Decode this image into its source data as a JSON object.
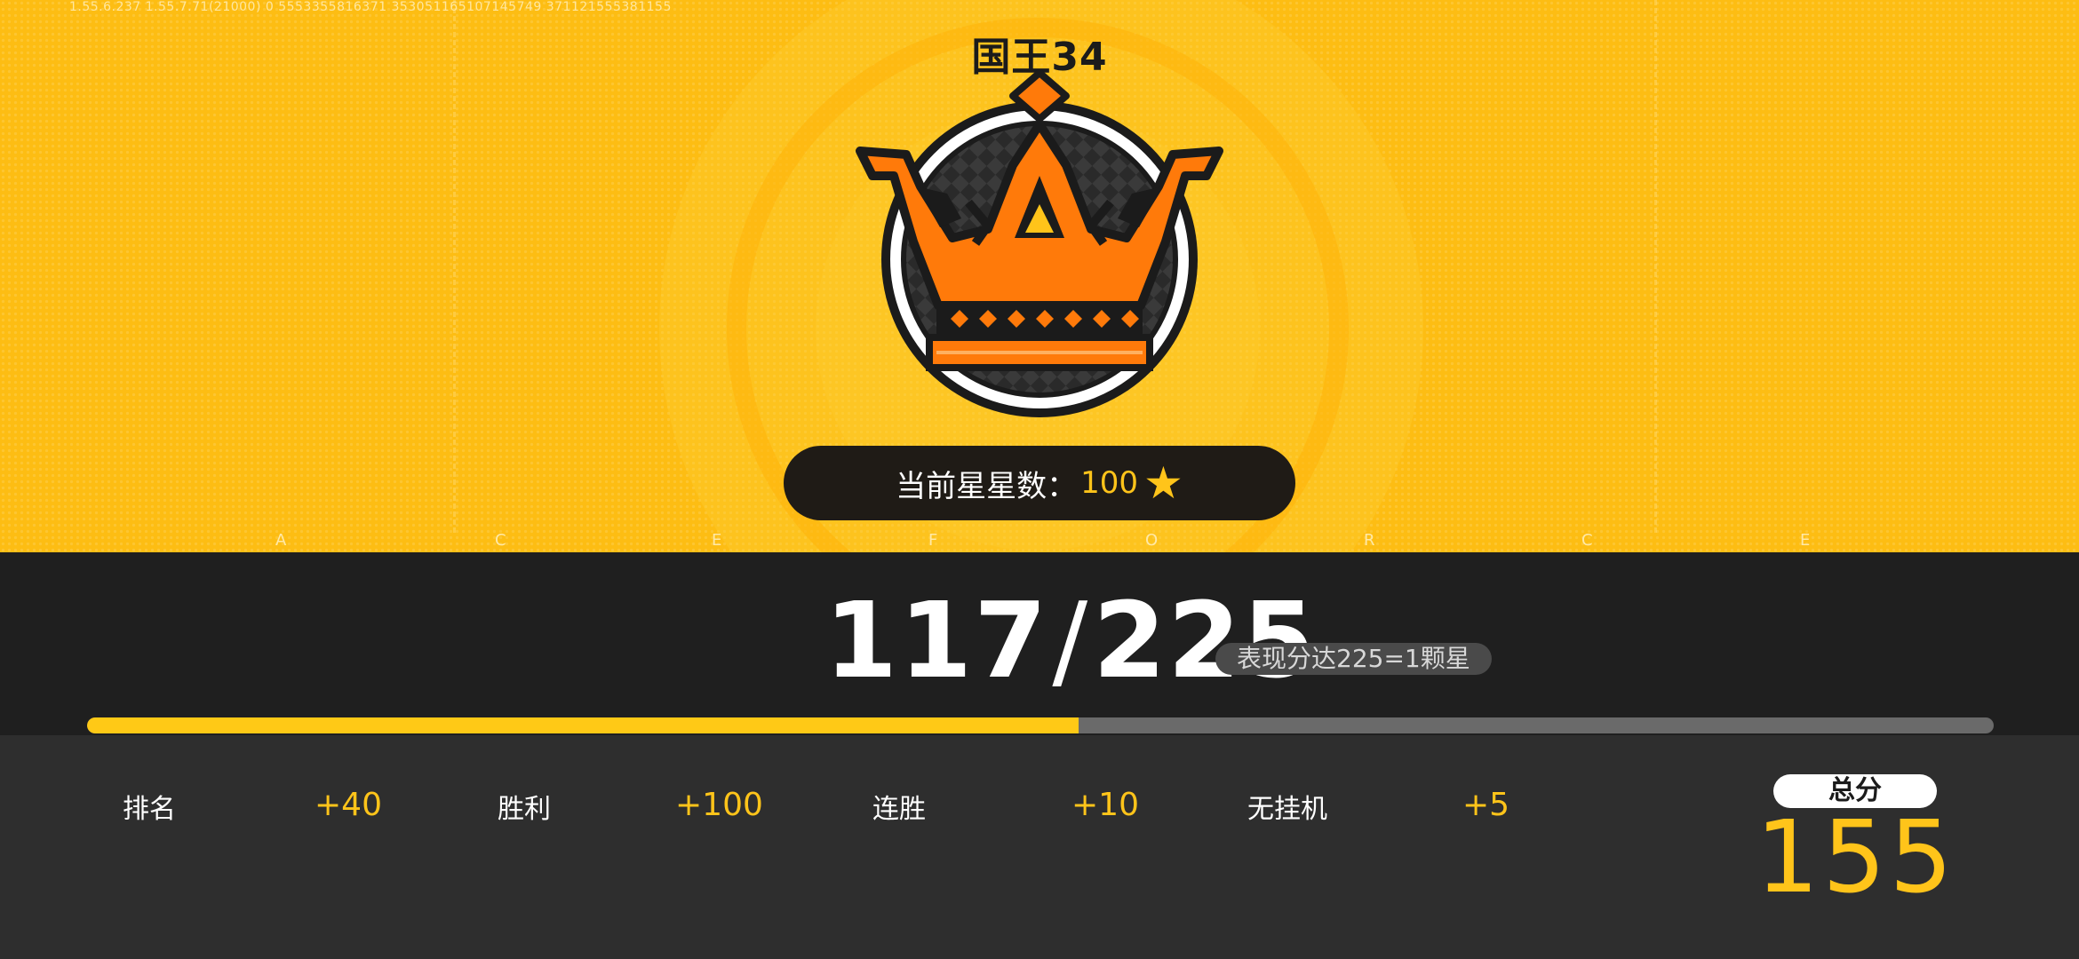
{
  "header": {
    "version_text": "1.55.6.237  1.55.7.71(21000)  0  5553355816371  353051165107145749  371121555381155",
    "rank_title": "国王34"
  },
  "stars": {
    "label": "当前星星数：",
    "value": "100",
    "icon": "star-icon",
    "star_glyph": "★"
  },
  "deco_letters": [
    "A",
    "C",
    "E",
    "F",
    "O",
    "R",
    "C",
    "E"
  ],
  "progress": {
    "current": "117",
    "separator": "/",
    "target": "225",
    "fraction": 0.52,
    "rule_text": "表现分达225=1颗星"
  },
  "scores": [
    {
      "label": "排名",
      "value": "+40"
    },
    {
      "label": "胜利",
      "value": "+100"
    },
    {
      "label": "连胜",
      "value": "+10"
    },
    {
      "label": "无挂机",
      "value": "+5"
    }
  ],
  "total": {
    "label": "总分",
    "value": "155"
  },
  "colors": {
    "background_yellow": "#fdbd13",
    "accent_gold": "#ffc41a",
    "crown_orange": "#ff7a0a",
    "dark_band": "#1f1f1f",
    "score_panel": "#2e2e2e"
  }
}
